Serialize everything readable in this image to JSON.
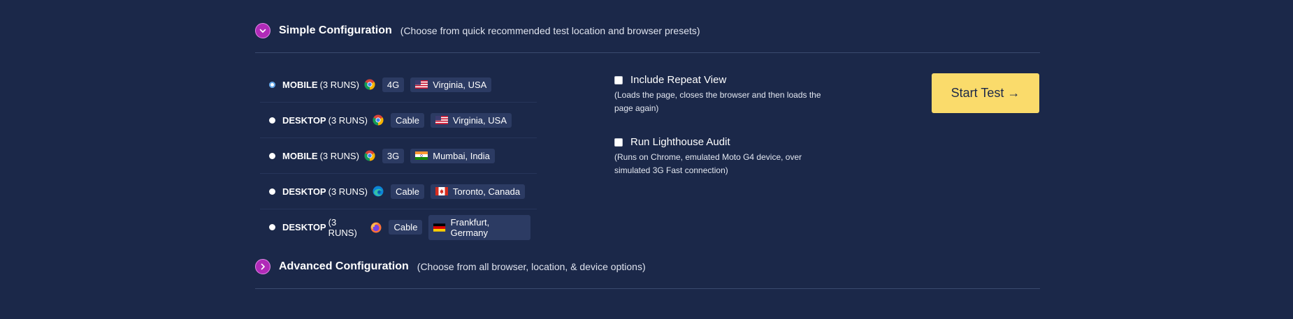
{
  "simple": {
    "title": "Simple Configuration",
    "subtitle": "(Choose from quick recommended test location and browser presets)"
  },
  "presets": [
    {
      "device": "MOBILE",
      "runs": "(3 RUNS)",
      "browser": "chrome",
      "connection": "4G",
      "location": "Virginia, USA",
      "flag": "us",
      "selected": true
    },
    {
      "device": "DESKTOP",
      "runs": "(3 RUNS)",
      "browser": "chrome",
      "connection": "Cable",
      "location": "Virginia, USA",
      "flag": "us",
      "selected": false
    },
    {
      "device": "MOBILE",
      "runs": "(3 RUNS)",
      "browser": "chrome",
      "connection": "3G",
      "location": "Mumbai, India",
      "flag": "in",
      "selected": false
    },
    {
      "device": "DESKTOP",
      "runs": "(3 RUNS)",
      "browser": "edge",
      "connection": "Cable",
      "location": "Toronto, Canada",
      "flag": "ca",
      "selected": false
    },
    {
      "device": "DESKTOP",
      "runs": "(3 RUNS)",
      "browser": "firefox",
      "connection": "Cable",
      "location": "Frankfurt, Germany",
      "flag": "de",
      "selected": false
    }
  ],
  "options": {
    "repeat_view": {
      "label": "Include Repeat View",
      "description": "(Loads the page, closes the browser and then loads the page again)",
      "checked": false
    },
    "lighthouse": {
      "label": "Run Lighthouse Audit",
      "description": "(Runs on Chrome, emulated Moto G4 device, over simulated 3G Fast connection)",
      "checked": false
    }
  },
  "start_button": {
    "label": "Start Test →"
  },
  "advanced": {
    "title": "Advanced Configuration",
    "subtitle": "(Choose from all browser, location, & device options)"
  },
  "colors": {
    "background": "#1b2849",
    "accent": "#b02ab8",
    "button": "#fadb6b"
  }
}
